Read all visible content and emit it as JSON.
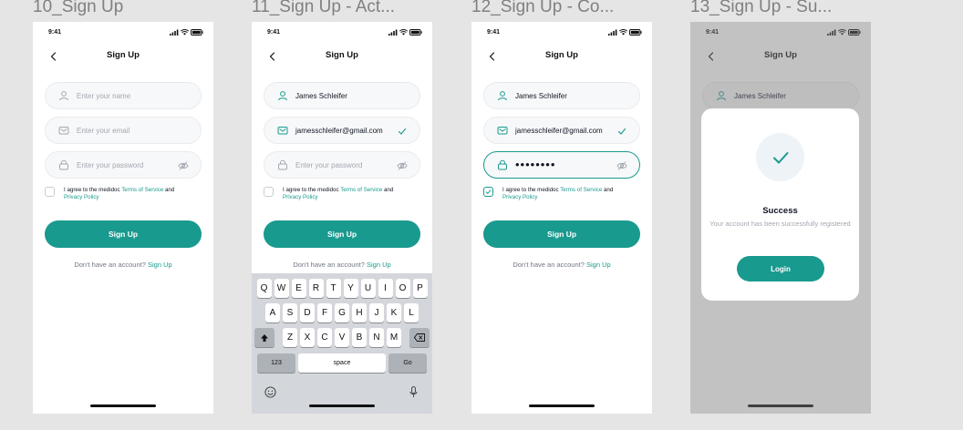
{
  "frames": [
    {
      "title": "10_Sign Up"
    },
    {
      "title": "11_Sign Up - Act..."
    },
    {
      "title": "12_Sign Up - Co..."
    },
    {
      "title": "13_Sign Up - Su..."
    }
  ],
  "status_time": "9:41",
  "header_title": "Sign Up",
  "placeholders": {
    "name": "Enter your name",
    "email": "Enter your email",
    "password": "Enter your password"
  },
  "values": {
    "name": "James Schleifer",
    "email": "jamesschleifer@gmail.com",
    "password_mask": "••••••••"
  },
  "terms": {
    "prefix": "I agree to the medidoc ",
    "tos_link": "Terms of Service",
    "and": " and",
    "privacy_link": "Privacy Policy"
  },
  "signup_button": "Sign Up",
  "footer": {
    "text": "Don't have an account? ",
    "link": "Sign Up"
  },
  "keyboard": {
    "row1": [
      "Q",
      "W",
      "E",
      "R",
      "T",
      "Y",
      "U",
      "I",
      "O",
      "P"
    ],
    "row2": [
      "A",
      "S",
      "D",
      "F",
      "G",
      "H",
      "J",
      "K",
      "L"
    ],
    "row3": [
      "Z",
      "X",
      "C",
      "V",
      "B",
      "N",
      "M"
    ],
    "numbers_key": "123",
    "space_key": "space",
    "go_key": "Go"
  },
  "success": {
    "title": "Success",
    "message": "Your account has been successfully registered",
    "login_button": "Login"
  },
  "colors": {
    "accent": "#199a8e",
    "field_bg": "#f7f8f9",
    "placeholder": "#a1a8b0",
    "text": "#101623",
    "canvas": "#e5e5e5"
  }
}
